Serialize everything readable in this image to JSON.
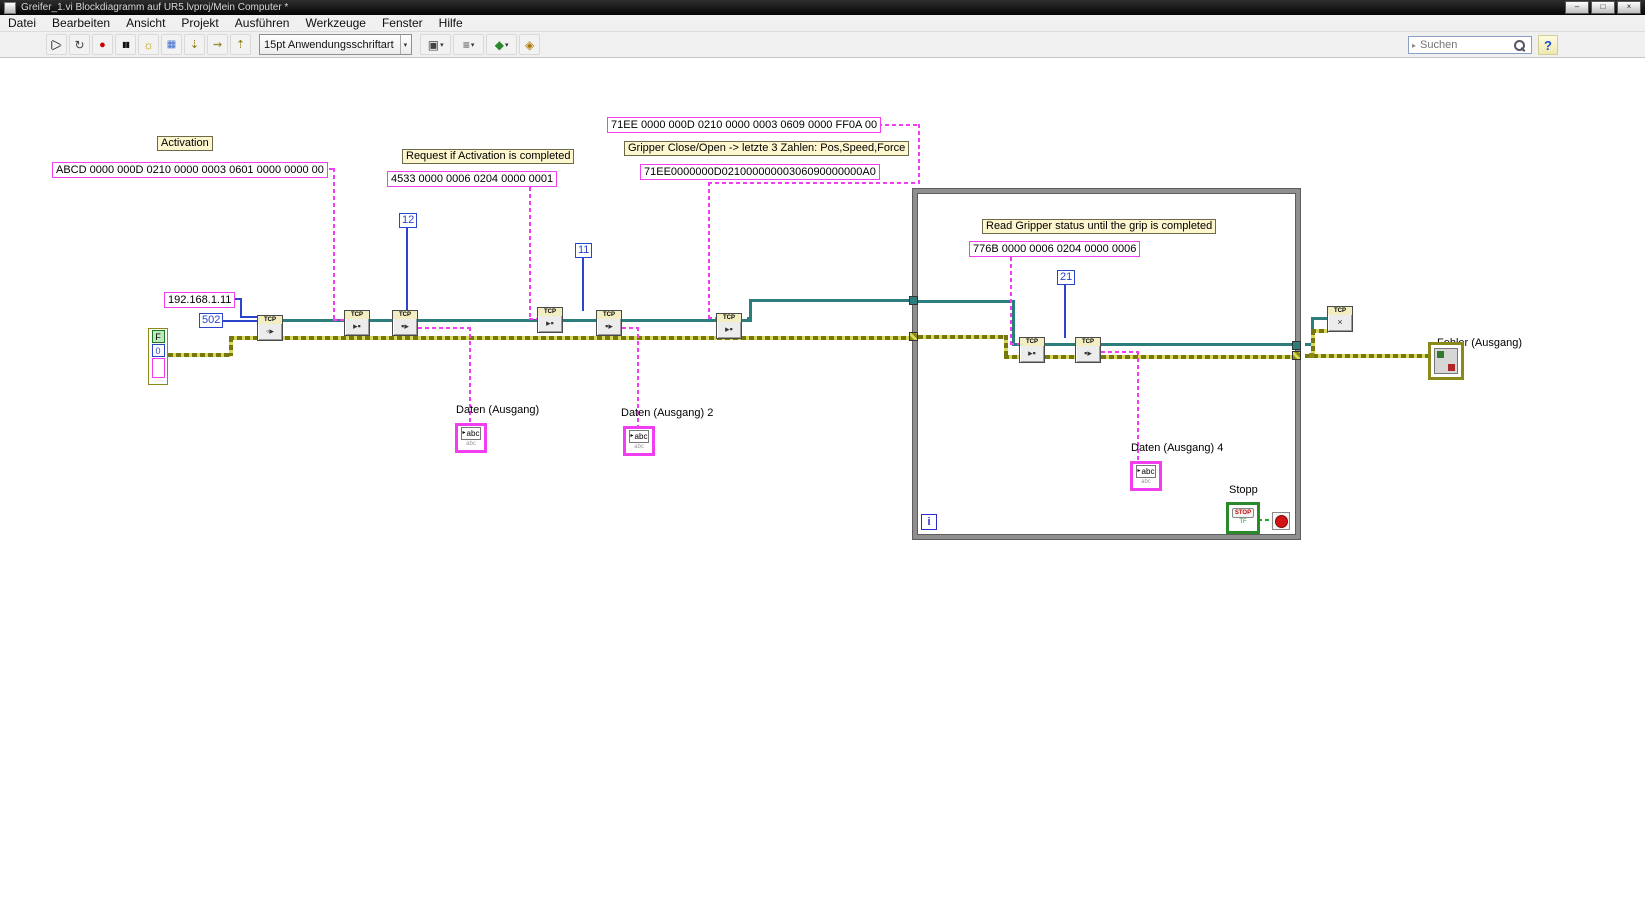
{
  "window": {
    "title": "Greifer_1.vi Blockdiagramm auf UR5.lvproj/Mein Computer *",
    "controls": {
      "minimize": "–",
      "maximize": "□",
      "close": "×"
    }
  },
  "menu": {
    "items": [
      "Datei",
      "Bearbeiten",
      "Ansicht",
      "Projekt",
      "Ausführen",
      "Werkzeuge",
      "Fenster",
      "Hilfe"
    ]
  },
  "toolbar": {
    "font_selector": "15pt Anwendungsschriftart",
    "search": {
      "placeholder": "Suchen"
    },
    "icons": {
      "run": "▶",
      "run_continuous": "↻",
      "abort": "●",
      "pause": "▮▮",
      "highlight_execution": "☼",
      "retain_wire_values": "▦",
      "step_into": "⇣",
      "step_over": "⇝",
      "step_out": "⇡",
      "dropdown_arrow": "▾",
      "align_objects": "▣",
      "distribute_objects": "≡",
      "reorder": "◆",
      "clean_up_diagram": "◈",
      "search_scope": "▸",
      "help": "?"
    }
  },
  "diagram": {
    "tcp_label": "TCP",
    "node_glyphs": {
      "open": "◦▸",
      "write": "▸▪",
      "read": "▪▸",
      "close": "×"
    },
    "labels": {
      "activation": "Activation",
      "request_completed": "Request if Activation is completed",
      "gripper_close_open": "Gripper Close/Open -> letzte 3 Zahlen: Pos,Speed,Force",
      "read_gripper_status": "Read Gripper status until the grip is completed"
    },
    "string_constants": {
      "activation_command": "ABCD 0000 000D 0210 0000 0003 0601 0000 0000 00",
      "request_command": "4533 0000 0006 0204 0000 0001",
      "gripper_command_hex": "71EE 0000 000D 0210 0000 0003 0609 0000 FF0A 00",
      "gripper_command_compact": "71EE0000000D02100000000306090000000A0",
      "status_command": "776B 0000 0006 0204 0000 0006",
      "ip_address": "192.168.1.11"
    },
    "numeric_constants": {
      "port": "502",
      "bytes_read_1": "12",
      "bytes_read_2": "11",
      "bytes_read_3": "21"
    },
    "error_cluster": {
      "status": "F",
      "code": "0"
    },
    "indicators": {
      "daten_1": "Daten (Ausgang)",
      "daten_2": "Daten (Ausgang) 2",
      "daten_4": "Daten (Ausgang) 4",
      "fehler": "Fehler (Ausgang)",
      "stopp": "Stopp",
      "string_icon_text": "abc",
      "string_marker": "▸",
      "stop_button_text": "STOP",
      "boolean_tf": "TF"
    },
    "loop": {
      "iterator": "i"
    }
  }
}
